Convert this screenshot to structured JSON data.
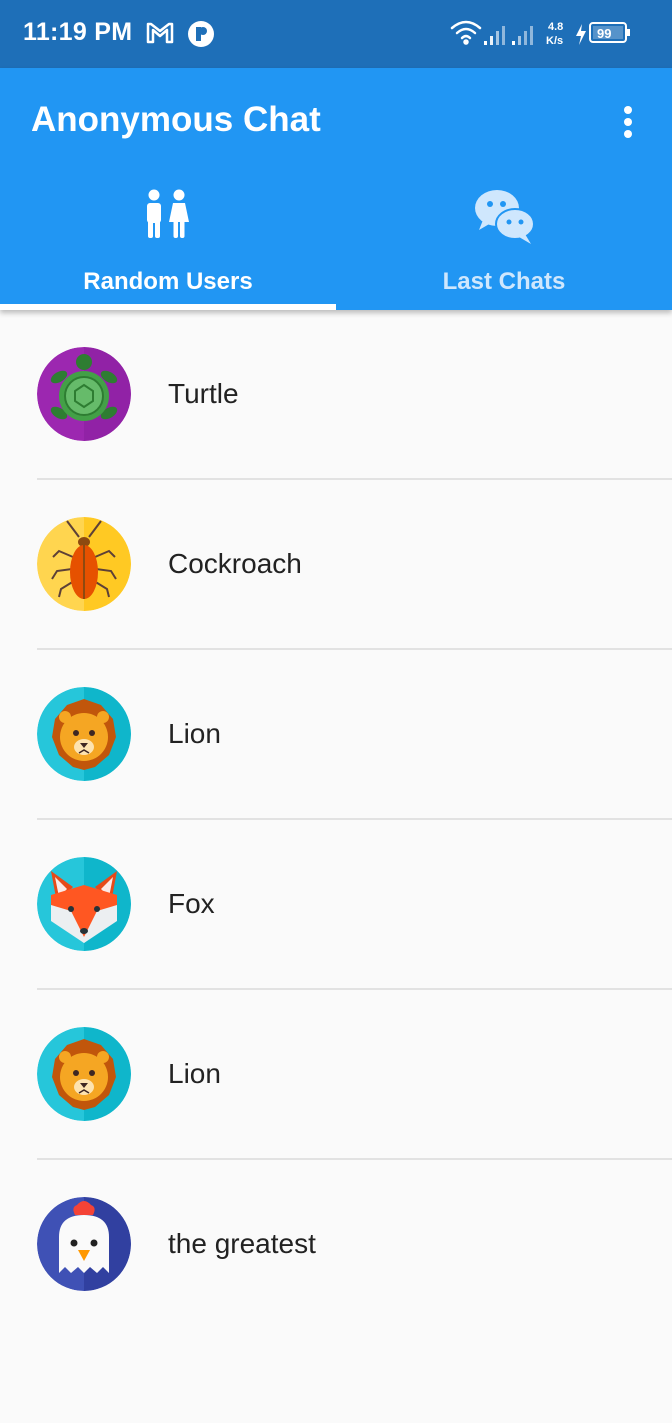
{
  "status_bar": {
    "time": "11:19 PM",
    "network_speed_value": "4.8",
    "network_speed_unit": "K/s",
    "battery": "99",
    "icons": [
      "gmail-icon",
      "app-notification-icon",
      "wifi-icon",
      "signal-icon",
      "signal-icon",
      "charging-icon",
      "battery-icon"
    ]
  },
  "app_bar": {
    "title": "Anonymous Chat",
    "menu_icon": "more-vert-icon",
    "background": "#2196f3"
  },
  "tabs": [
    {
      "label": "Random Users",
      "icon": "users-icon",
      "selected": true
    },
    {
      "label": "Last Chats",
      "icon": "chat-bubbles-icon",
      "selected": false
    }
  ],
  "users": [
    {
      "name": "Turtle",
      "avatar": "turtle-avatar"
    },
    {
      "name": "Cockroach",
      "avatar": "cockroach-avatar"
    },
    {
      "name": "Lion",
      "avatar": "lion-avatar"
    },
    {
      "name": "Fox",
      "avatar": "fox-avatar"
    },
    {
      "name": "Lion",
      "avatar": "lion-avatar"
    },
    {
      "name": "the greatest",
      "avatar": "chicken-avatar"
    }
  ]
}
